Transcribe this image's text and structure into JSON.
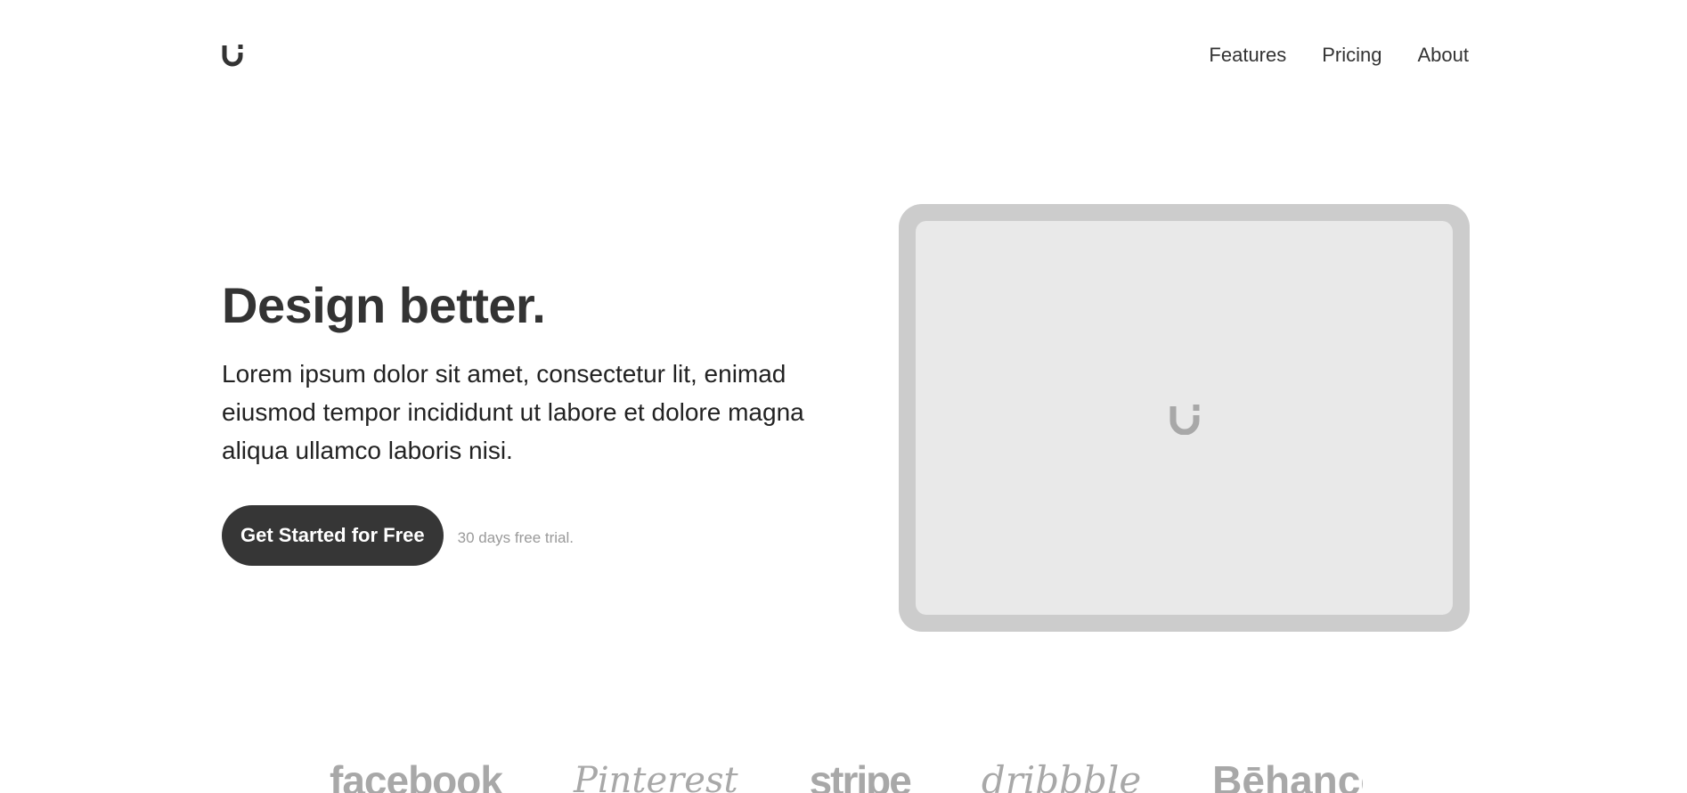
{
  "header": {
    "logo_icon": "u-magnet-logo-icon",
    "nav": [
      {
        "label": "Features"
      },
      {
        "label": "Pricing"
      },
      {
        "label": "About"
      }
    ]
  },
  "hero": {
    "title": "Design better.",
    "description": "Lorem ipsum dolor sit amet, consectetur lit, enimad eiusmod tempor incididunt ut labore et dolore magna aliqua ullamco laboris nisi.",
    "cta_label": "Get Started for Free",
    "trial_note": "30 days free trial."
  },
  "device": {
    "screen_icon": "u-magnet-logo-icon"
  },
  "brands": [
    {
      "name": "facebook"
    },
    {
      "name": "Pinterest"
    },
    {
      "name": "stripe"
    },
    {
      "name": "dribbble"
    },
    {
      "name": "Bēhance"
    }
  ],
  "colors": {
    "text": "#333333",
    "button_bg": "#363636",
    "button_text": "#ffffff",
    "device_frame": "#cccccc",
    "device_screen": "#e9e9e9",
    "muted": "#9a9a9a",
    "brand_gray": "#a8a8a8"
  }
}
